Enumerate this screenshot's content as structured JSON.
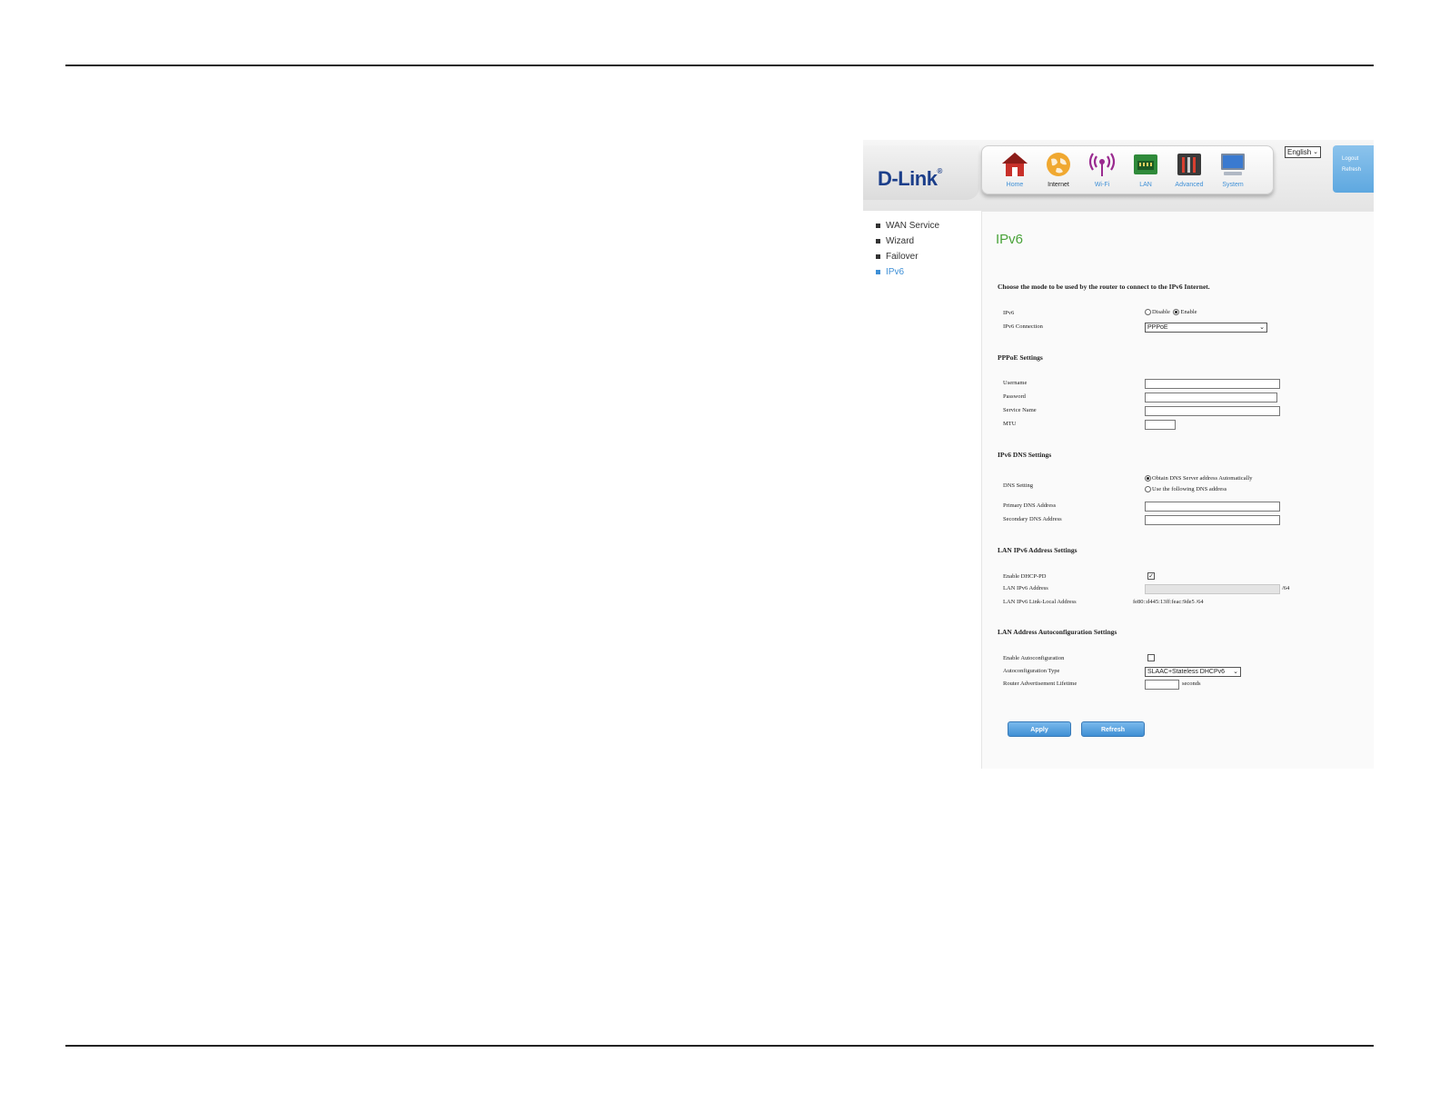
{
  "header": {
    "logo": "D-Link",
    "logo_mark": "®",
    "nav": [
      {
        "label": "Home",
        "icon": "home-icon"
      },
      {
        "label": "Internet",
        "icon": "globe-icon"
      },
      {
        "label": "Wi-Fi",
        "icon": "wifi-icon"
      },
      {
        "label": "LAN",
        "icon": "lan-port-icon"
      },
      {
        "label": "Advanced",
        "icon": "tools-icon"
      },
      {
        "label": "System",
        "icon": "computer-icon"
      }
    ],
    "language": "English",
    "logout_label": "Logout",
    "refresh_label": "Refresh"
  },
  "sidebar": {
    "items": [
      {
        "label": "WAN Service"
      },
      {
        "label": "Wizard"
      },
      {
        "label": "Failover"
      },
      {
        "label": "IPv6",
        "active": true
      }
    ]
  },
  "main": {
    "title": "IPv6",
    "intro": "Choose the mode to be used by the router to connect to the IPv6 Internet.",
    "ipv6": {
      "label": "IPv6",
      "disable_label": "Disable",
      "enable_label": "Enable",
      "selected": "Enable"
    },
    "connection": {
      "label": "IPv6 Connection",
      "value": "PPPoE"
    },
    "pppoe": {
      "section": "PPPoE Settings",
      "username_label": "Username",
      "password_label": "Password",
      "service_name_label": "Service Name",
      "mtu_label": "MTU"
    },
    "dns": {
      "section": "IPv6 DNS Settings",
      "setting_label": "DNS Setting",
      "auto_label": "Obtain DNS Server address Automatically",
      "manual_label": "Use the following DNS address",
      "selected": "auto",
      "primary_label": "Primary DNS Address",
      "secondary_label": "Secondary DNS Address"
    },
    "lan_ipv6": {
      "section": "LAN IPv6 Address Settings",
      "dhcp_pd_label": "Enable DHCP-PD",
      "dhcp_pd_checked": true,
      "address_label": "LAN IPv6 Address",
      "address_suffix": "/64",
      "link_local_label": "LAN IPv6 Link-Local Address",
      "link_local_value": "fe80::d445:13ff:feac:9de5 /64"
    },
    "autoconf": {
      "section": "LAN Address Autoconfiguration Settings",
      "enable_label": "Enable Autoconfiguration",
      "enable_checked": false,
      "type_label": "Autoconfiguration Type",
      "type_value": "SLAAC+Stateless DHCPv6",
      "lifetime_label": "Router Advertisement Lifetime",
      "lifetime_unit": "seconds"
    },
    "apply_label": "Apply",
    "refresh_label": "Refresh"
  },
  "colors": {
    "title_green": "#4aa33a",
    "active_blue": "#3e8fd6",
    "button_blue": "#3f8fd4",
    "logo_blue": "#1b3e8a"
  }
}
